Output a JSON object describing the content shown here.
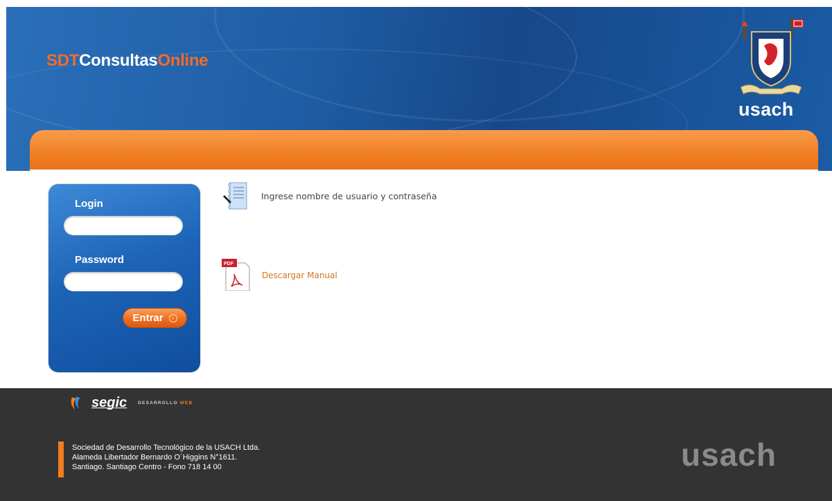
{
  "header": {
    "brand_part1": "SDT",
    "brand_part2": "Consultas",
    "brand_part3": "Online",
    "logo_text": "usach",
    "crest_icon": "university-crest-icon"
  },
  "login": {
    "login_label": "Login",
    "login_value": "",
    "password_label": "Password",
    "password_value": "",
    "submit_label": "Entrar",
    "submit_icon": "arrow-circle-icon"
  },
  "main": {
    "instruction_icon": "document-pen-icon",
    "instruction": "Ingrese nombre de usuario y contraseña",
    "manual_icon": "pdf-icon",
    "manual_link": "Descargar Manual"
  },
  "footer": {
    "partner_name": "segic",
    "partner_tag_1": "DESARROLLO",
    "partner_tag_2": "WEB",
    "address_line1": "Sociedad de Desarrollo Tecnológico de la USACH Ltda.",
    "address_line2": "Alameda Libertador Bernardo O´Higgins N°1611.",
    "address_line3": "Santiago. Santiago Centro - Fono 718 14 00",
    "logo_text": "usach"
  },
  "colors": {
    "header_blue": "#1f5ea5",
    "accent_orange": "#f07e22",
    "footer_gray": "#333333"
  }
}
